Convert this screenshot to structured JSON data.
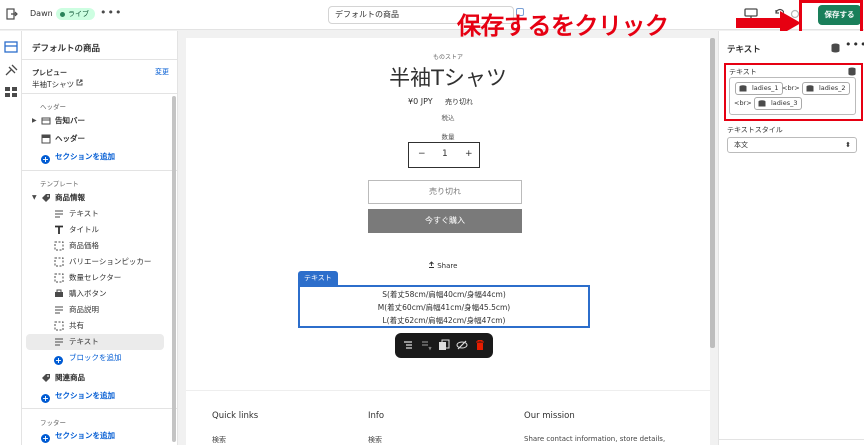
{
  "topbar": {
    "theme_name": "Dawn",
    "live_badge": "ライブ",
    "more": "•••",
    "template_select": "デフォルトの商品",
    "save_label": "保存する"
  },
  "callout": {
    "text": "保存するをクリック",
    "color": "#e60012"
  },
  "sidebar": {
    "title": "デフォルトの商品",
    "preview_label": "プレビュー",
    "preview_change": "変更",
    "preview_product": "半袖Tシャツ",
    "header_group": "ヘッダー",
    "announcement_bar": "告知バー",
    "header": "ヘッダー",
    "add_section": "セクションを追加",
    "template_group": "テンプレート",
    "product_info": "商品情報",
    "blocks": [
      {
        "label": "テキスト",
        "icon": "text-lines-icon"
      },
      {
        "label": "タイトル",
        "icon": "title-t-icon"
      },
      {
        "label": "商品価格",
        "icon": "price-icon"
      },
      {
        "label": "バリエーションピッカー",
        "icon": "variant-picker-icon"
      },
      {
        "label": "数量セレクター",
        "icon": "quantity-icon"
      },
      {
        "label": "購入ボタン",
        "icon": "buy-button-icon"
      },
      {
        "label": "商品説明",
        "icon": "description-icon"
      },
      {
        "label": "共有",
        "icon": "share-icon"
      },
      {
        "label": "テキスト",
        "icon": "text-lines-icon"
      }
    ],
    "add_block": "ブロックを追加",
    "related_products": "関連商品",
    "footer_group": "フッター"
  },
  "canvas": {
    "store_name": "ものストア",
    "product_title": "半袖Tシャツ",
    "price": "¥0 JPY",
    "soldout_badge": "売り切れ",
    "tax_note": "税込",
    "quantity_label": "数量",
    "quantity_minus": "−",
    "quantity_value": "1",
    "quantity_plus": "+",
    "soldout_button": "売り切れ",
    "buy_now_button": "今すぐ購入",
    "share": "Share",
    "text_tag": "テキスト",
    "text_lines": [
      "S(着丈58cm/肩幅40cm/身幅44cm)",
      "M(着丈60cm/肩幅41cm/身幅45.5cm)",
      "L(着丈62cm/肩幅42cm/身幅47cm)"
    ],
    "footer": {
      "quick_links": "Quick links",
      "quick_links_item": "検索",
      "info": "Info",
      "info_item": "検索",
      "mission": "Our mission",
      "mission_text": "Share contact information, store details,"
    }
  },
  "right_panel": {
    "title": "テキスト",
    "field_label": "テキスト",
    "pills": [
      "ladies_1",
      "ladies_2",
      "ladies_3"
    ],
    "br": "<br>",
    "style_label": "テキストスタイル",
    "style_value": "本文"
  }
}
